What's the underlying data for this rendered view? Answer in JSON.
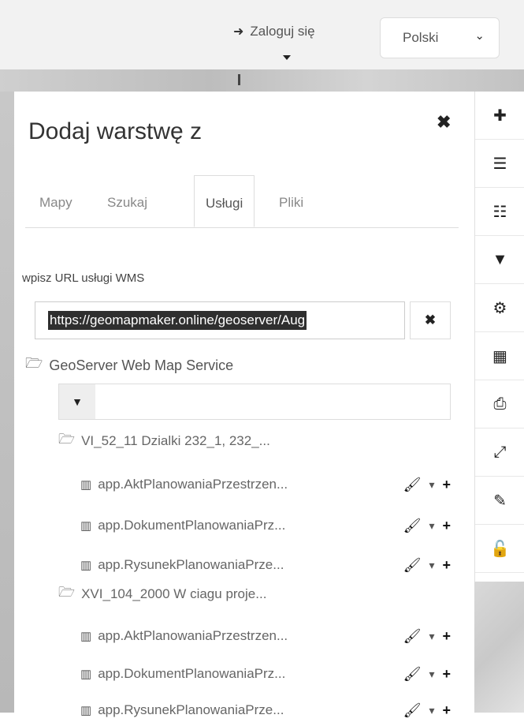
{
  "header": {
    "login_label": "Zaloguj się",
    "language": "Polski"
  },
  "panel": {
    "title": "Dodaj warstwę z",
    "tabs": [
      {
        "label": "Mapy"
      },
      {
        "label": "Szukaj"
      },
      {
        "label": "Usługi",
        "active": true
      },
      {
        "label": "Pliki"
      }
    ],
    "wms_label": "wpisz URL usługi WMS",
    "url_value": "https://geomapmaker.online/geoserver/Aug",
    "root_label": "GeoServer Web Map Service",
    "filter_value": "",
    "groups": [
      {
        "label": "VI_52_11 Dzialki 232_1, 232_...",
        "layers": [
          {
            "label": "app.AktPlanowaniaPrzestrzen..."
          },
          {
            "label": "app.DokumentPlanowaniaPrz..."
          },
          {
            "label": "app.RysunekPlanowaniaPrze..."
          }
        ]
      },
      {
        "label": "XVI_104_2000 W ciagu proje...",
        "layers": [
          {
            "label": "app.AktPlanowaniaPrzestrzen..."
          },
          {
            "label": "app.DokumentPlanowaniaPrz..."
          },
          {
            "label": "app.RysunekPlanowaniaPrze..."
          }
        ]
      }
    ]
  },
  "toolbar": {
    "icons": [
      "plus-icon",
      "lines-icon",
      "list-icon",
      "filter-icon",
      "settings-icon",
      "map-icon",
      "print-icon",
      "measure-icon",
      "pencil-icon",
      "unlock-icon"
    ]
  },
  "icons": {
    "login": "sign-in-icon",
    "close": "close-icon",
    "folder": "folder-open-icon",
    "layer": "layers-icon",
    "brush": "brush-icon",
    "minus": "minus-icon",
    "plus": "plus-icon"
  }
}
